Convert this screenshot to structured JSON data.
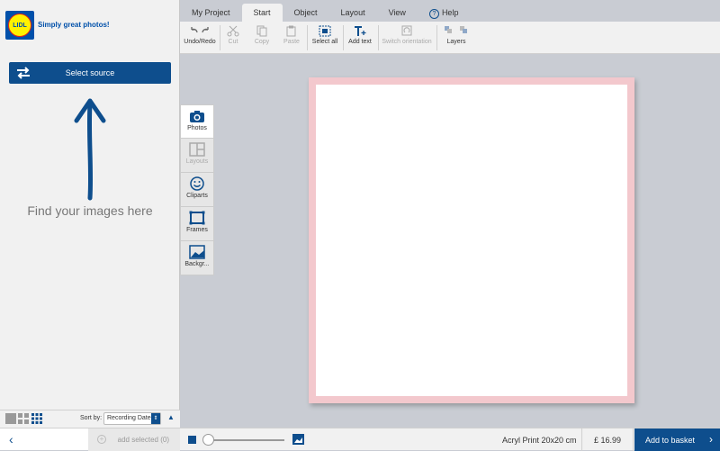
{
  "brand": {
    "logo_text": "LIDL",
    "tagline": "Simply great photos!"
  },
  "left_panel": {
    "select_source_label": "Select source",
    "hint": "Find your images here",
    "sort_label": "Sort by:",
    "sort_value": "Recording Date",
    "add_selected_label": "add selected (0)"
  },
  "tabs": [
    {
      "label": "My Project"
    },
    {
      "label": "Start"
    },
    {
      "label": "Object"
    },
    {
      "label": "Layout"
    },
    {
      "label": "View"
    },
    {
      "label": "Help"
    }
  ],
  "toolbar": {
    "undo_redo": "Undo/Redo",
    "cut": "Cut",
    "copy": "Copy",
    "paste": "Paste",
    "select_all": "Select all",
    "add_text": "Add text",
    "switch_orientation": "Switch orientation",
    "layers": "Layers"
  },
  "side_tabs": [
    {
      "label": "Photos"
    },
    {
      "label": "Layouts"
    },
    {
      "label": "Cliparts"
    },
    {
      "label": "Frames"
    },
    {
      "label": "Backgr..."
    }
  ],
  "footer": {
    "product": "Acryl Print 20x20 cm",
    "price": "£ 16.99",
    "basket_label": "Add to basket"
  },
  "colors": {
    "accent": "#0e4e8d",
    "canvas_border": "#f3c8cd",
    "workspace": "#c9ccd3"
  }
}
